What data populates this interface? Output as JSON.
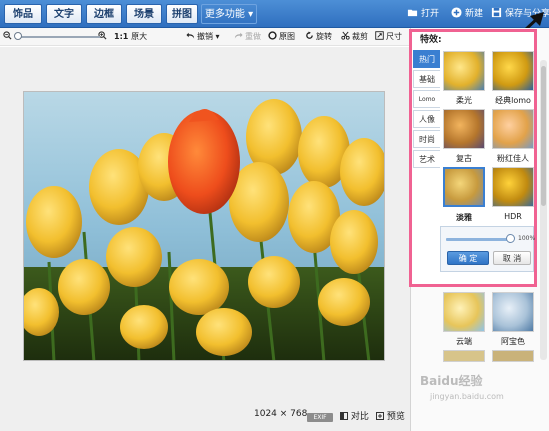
{
  "topbar": {
    "tabs": [
      {
        "label": "饰品"
      },
      {
        "label": "文字"
      },
      {
        "label": "边框"
      },
      {
        "label": "场景"
      },
      {
        "label": "拼图"
      }
    ],
    "more_label": "更多功能",
    "open_label": "打开",
    "new_label": "新建",
    "save_label": "保存与分享"
  },
  "toolbar": {
    "actual_size_scale": "1:1",
    "actual_size_label": "原大",
    "undo_label": "撤销",
    "redo_label": "重做",
    "original_label": "原图",
    "rotate_label": "旋转",
    "crop_label": "裁剪",
    "resize_label": "尺寸"
  },
  "status": {
    "dimensions": "1024 × 768",
    "exif_label": "EXIF",
    "compare_label": "对比",
    "preview_label": "预览"
  },
  "panel": {
    "title": "特效:",
    "categories": [
      {
        "label": "热门"
      },
      {
        "label": "基础"
      },
      {
        "label": "Lomo"
      },
      {
        "label": "人像"
      },
      {
        "label": "时尚"
      },
      {
        "label": "艺术"
      }
    ],
    "effects": [
      {
        "label": "柔光"
      },
      {
        "label": "经典lomo"
      },
      {
        "label": "复古"
      },
      {
        "label": "粉红佳人"
      },
      {
        "label": "淡雅"
      },
      {
        "label": "HDR"
      },
      {
        "label": "云端"
      },
      {
        "label": "阿宝色"
      }
    ],
    "intensity_value": "100%",
    "confirm_label": "确 定",
    "cancel_label": "取 消"
  },
  "watermark": {
    "logo_text": "Baidu经验",
    "url": "jingyan.baidu.com"
  },
  "colors": {
    "accent": "#3a7fd1",
    "highlight_border": "#f06292",
    "topbar": "#2f6fbf"
  }
}
